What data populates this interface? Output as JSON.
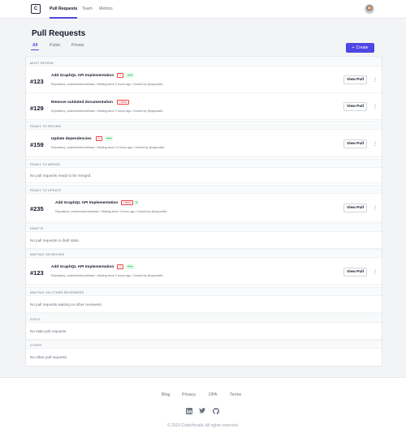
{
  "logo_glyph": "C",
  "nav": {
    "tabs": [
      "Pull Requests",
      "Team",
      "Metrics"
    ]
  },
  "page": {
    "title": "Pull Requests",
    "subtabs": [
      "All",
      "Public",
      "Private"
    ],
    "create_label": "Create"
  },
  "view_label": "View Pull",
  "sections": {
    "must_review": "MUST REVIEW",
    "ready_to_review": "READY TO REVIEW",
    "ready_to_merge": "READY TO MERGE",
    "ready_to_update": "READY TO UPDATE",
    "drafts": "DRAFTS",
    "waiting_on_review": "WAITING ON REVIEW",
    "waiting_on_other": "WAITING ON OTHER REVIEWERS",
    "stale": "STALE",
    "other": "OTHER"
  },
  "prs": [
    {
      "number": "#123",
      "title": "Add GraphQL API Implementation",
      "label_red": "!!",
      "label_green": "+++",
      "meta": "Repository: codeherald/codebase  •  Waiting since 3 hours ago  •  Owned by @sayonalfo"
    },
    {
      "number": "#129",
      "title": "Remove outdated documentation",
      "label_red": "! failed",
      "meta": "Repository: codeherald/codebase  •  Waiting since 1 hours ago  •  Owned by @sayonalfo"
    },
    {
      "number": "#159",
      "title": "Update dependencies",
      "label_red": "!!",
      "label_green": "+++",
      "meta": "Repository: codeherald/codebase  •  Waiting since 14 hours ago  •  Owned by @sayonalfo"
    },
    {
      "number": "#235",
      "title": "Add GraphQL API Implementation",
      "label_red": "! failed",
      "label_green": "+",
      "meta": "Repository: codeherald/codebase  •  Waiting since 3 hours ago  •  Owned by @sayonalfo"
    },
    {
      "number": "#123",
      "title": "Add GraphQL API Implementation",
      "label_red": "!!",
      "label_green": "+++",
      "meta": "Repository: codeherald/codebase  •  Waiting since 3 hours ago  •  Owned by @sayonalfo"
    }
  ],
  "empty": {
    "ready_to_merge": "No pull requests ready to be merged.",
    "drafts": "No pull requests in draft state.",
    "waiting_on_other": "No pull requests waiting on other reviewers.",
    "stale": "No stale pull requests.",
    "other": "No other pull requests."
  },
  "footer": {
    "links": [
      "Blog",
      "Privacy",
      "DPA",
      "Terms"
    ],
    "social_icons": [
      "linkedin-icon",
      "twitter-icon",
      "github-icon"
    ],
    "copyright": "© 2023 CodeHerald. All rights reserved."
  },
  "colors": {
    "accent": "#4f46e5",
    "danger": "#ef4444",
    "success": "#16a34a"
  }
}
